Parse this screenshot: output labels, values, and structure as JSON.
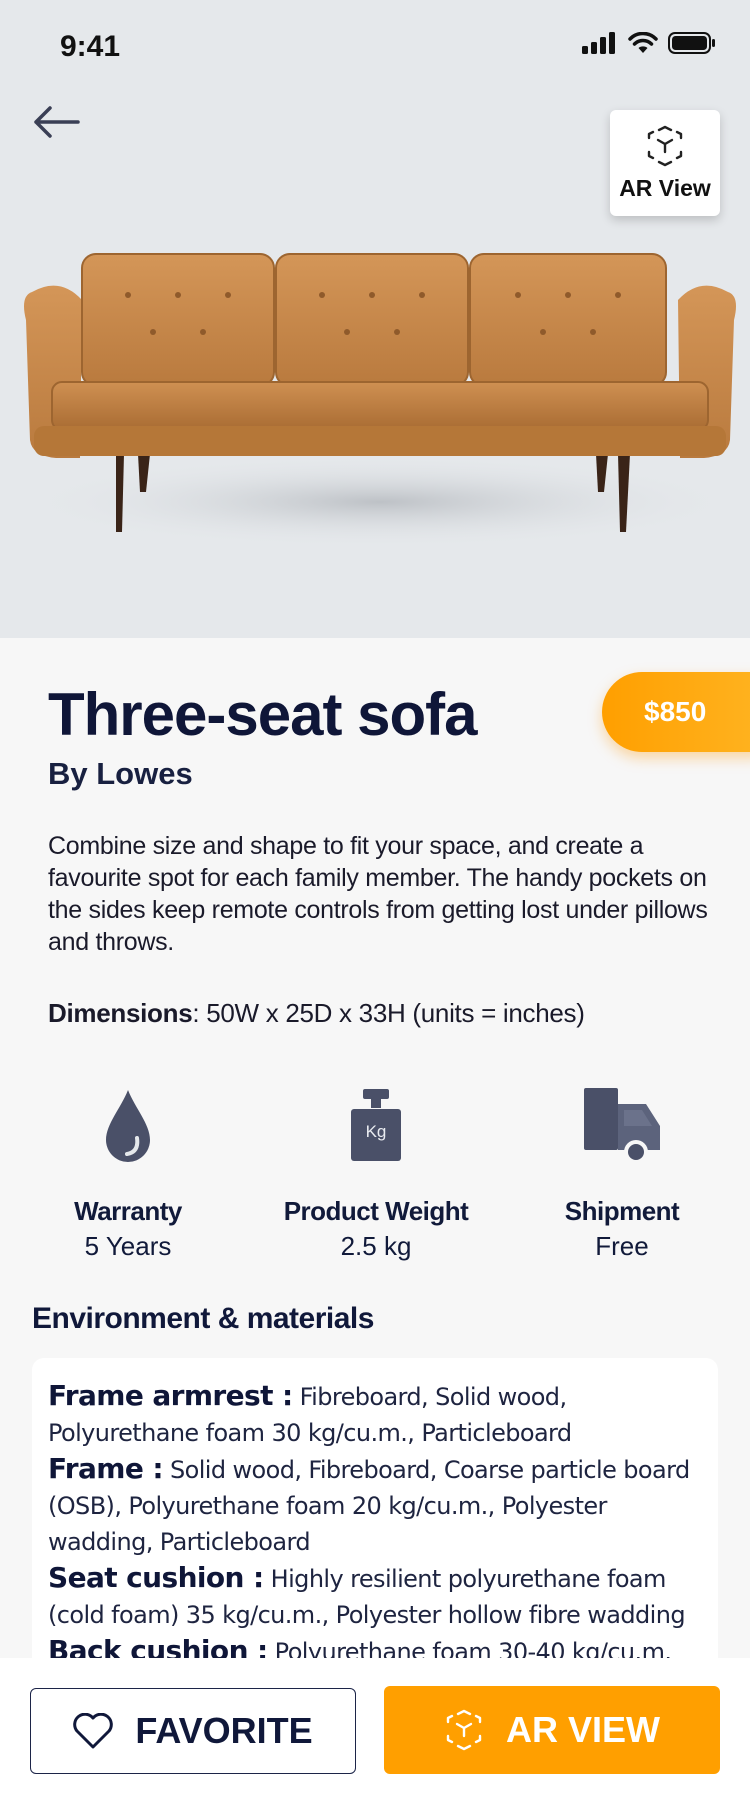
{
  "status_bar": {
    "time": "9:41"
  },
  "header": {
    "ar_chip_label": "AR View"
  },
  "product": {
    "title": "Three-seat sofa",
    "brand": "By Lowes",
    "price": "$850",
    "description": "Combine size and shape to fit your space, and create a favourite spot for each family member. The handy pockets on the sides keep remote controls from getting lost under pillows and throws.",
    "dimensions_label": "Dimensions",
    "dimensions_value": ": 50W  x  25D  x  33H (units = inches)"
  },
  "features": [
    {
      "icon": "water-drop-icon",
      "label": "Warranty",
      "value": "5 Years"
    },
    {
      "icon": "kg-weight-icon",
      "label": "Product Weight",
      "value": "2.5 kg",
      "icon_text": "Kg"
    },
    {
      "icon": "delivery-truck-icon",
      "label": "Shipment",
      "value": "Free"
    }
  ],
  "environment": {
    "heading": "Environment & materials",
    "items": [
      {
        "label": "Frame armrest :",
        "text": " Fibreboard, Solid wood, Polyurethane foam 30 kg/cu.m., Particleboard"
      },
      {
        "label": "Frame :",
        "text": " Solid wood, Fibreboard, Coarse particle board (OSB), Polyurethane foam 20 kg/cu.m., Polyester wadding, Particleboard"
      },
      {
        "label": "Seat cushion :",
        "text": " Highly resilient polyurethane foam (cold foam) 35 kg/cu.m., Polyester hollow fibre wadding"
      },
      {
        "label": "Back cushion :",
        "text": " Polyurethane foam 30-40 kg/cu.m."
      }
    ]
  },
  "actions": {
    "favorite_label": "FAVORITE",
    "ar_view_label": "AR VIEW"
  },
  "colors": {
    "accent": "#ff9f00",
    "navy": "#10183a",
    "hero_bg": "#e5e8eb",
    "sofa": "#c8884c",
    "icon": "#4a5068"
  }
}
